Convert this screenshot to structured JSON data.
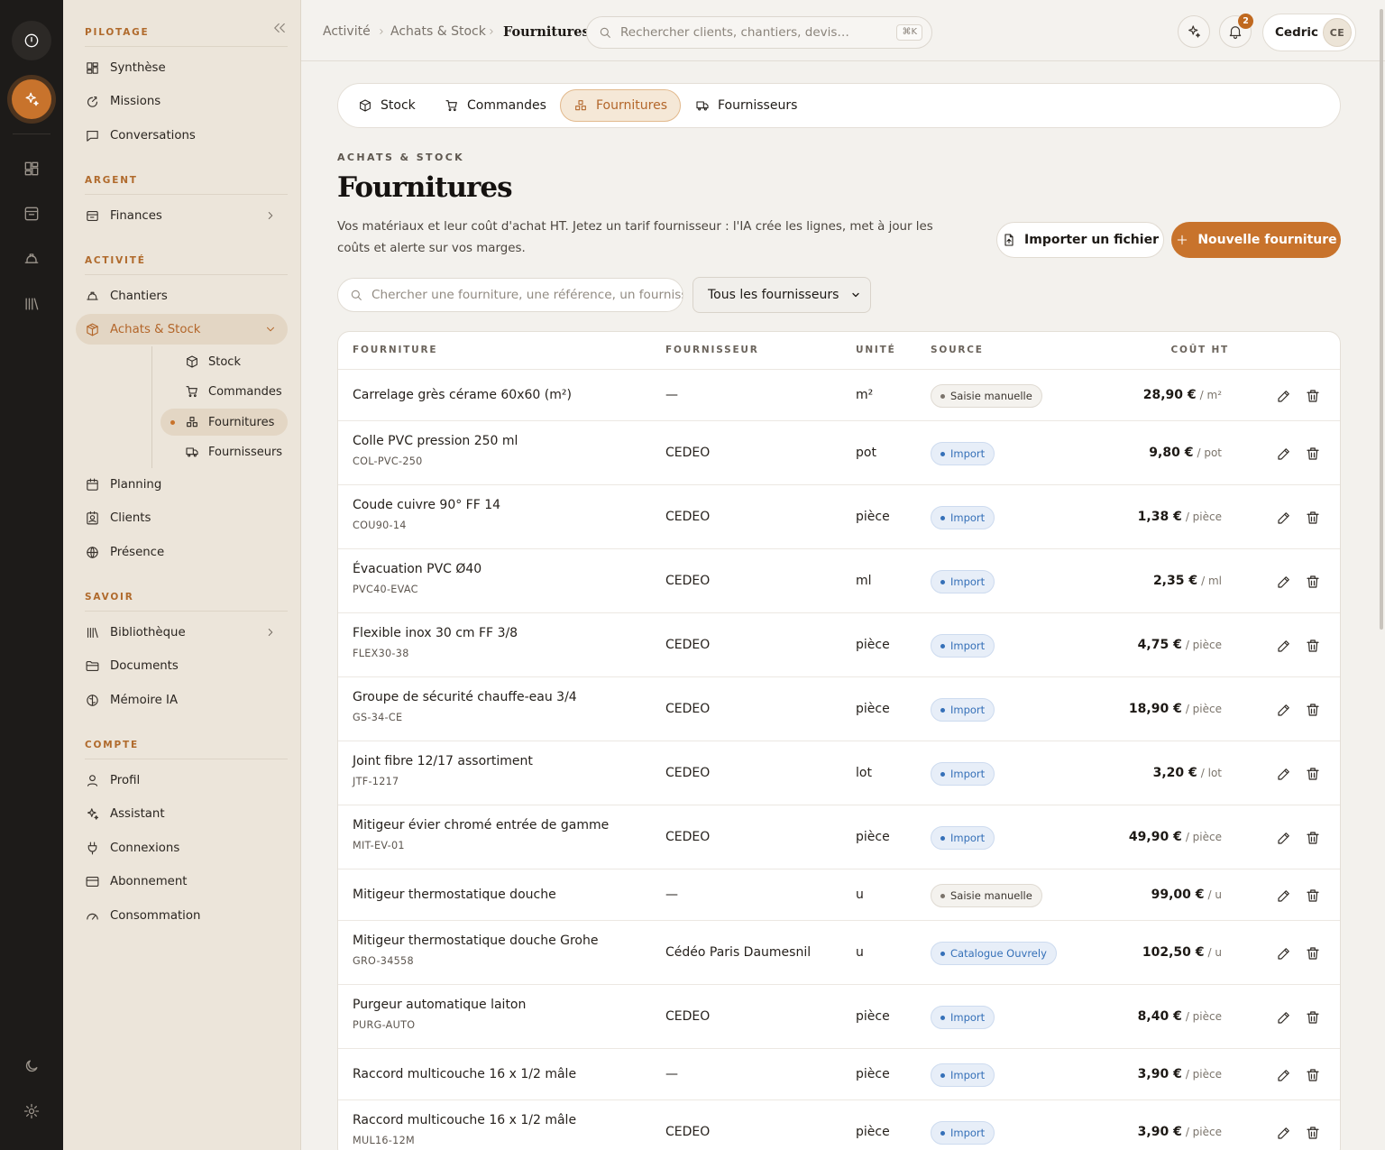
{
  "topbar": {
    "breadcrumb": [
      "Activité",
      "Achats & Stock",
      "Fournitures"
    ],
    "search_placeholder": "Rechercher clients, chantiers, devis…",
    "search_shortcut": "⌘K",
    "notifications_count": "2",
    "user_name": "Cedric",
    "user_initials": "CE"
  },
  "sidebar": {
    "sections": {
      "pilotage": "PILOTAGE",
      "argent": "ARGENT",
      "activite": "ACTIVITÉ",
      "savoir": "SAVOIR",
      "compte": "COMPTE"
    },
    "items": {
      "synthese": "Synthèse",
      "missions": "Missions",
      "conversations": "Conversations",
      "finances": "Finances",
      "chantiers": "Chantiers",
      "achats_stock": "Achats & Stock",
      "stock": "Stock",
      "commandes": "Commandes",
      "fournitures": "Fournitures",
      "fournisseurs": "Fournisseurs",
      "planning": "Planning",
      "clients": "Clients",
      "presence": "Présence",
      "bibliotheque": "Bibliothèque",
      "documents": "Documents",
      "memoire_ia": "Mémoire IA",
      "profil": "Profil",
      "assistant": "Assistant",
      "connexions": "Connexions",
      "abonnement": "Abonnement",
      "consommation": "Consommation"
    }
  },
  "tabs": [
    "Stock",
    "Commandes",
    "Fournitures",
    "Fournisseurs"
  ],
  "page": {
    "eyebrow": "ACHATS & STOCK",
    "title": "Fournitures",
    "description": "Vos matériaux et leur coût d'achat HT. Jetez un tarif fournisseur : l'IA crée les lignes, met à jour les coûts et alerte sur vos marges.",
    "import_button": "Importer un fichier",
    "new_button": "Nouvelle fourniture",
    "filter_placeholder": "Chercher une fourniture, une référence, un fournisseur",
    "supplier_filter": "Tous les fournisseurs"
  },
  "table": {
    "headers": {
      "fourniture": "FOURNITURE",
      "fournisseur": "FOURNISSEUR",
      "unite": "UNITÉ",
      "source": "SOURCE",
      "cout": "COÛT HT"
    },
    "rows": [
      {
        "name": "Carrelage grès cérame 60x60 (m²)",
        "ref": "",
        "supplier": "—",
        "unit": "m²",
        "source": "Saisie manuelle",
        "source_type": "manual",
        "price": "28,90 €",
        "price_unit": "/ m²"
      },
      {
        "name": "Colle PVC pression 250 ml",
        "ref": "COL-PVC-250",
        "supplier": "CEDEO",
        "unit": "pot",
        "source": "Import",
        "source_type": "import",
        "price": "9,80 €",
        "price_unit": "/ pot"
      },
      {
        "name": "Coude cuivre 90° FF 14",
        "ref": "COU90-14",
        "supplier": "CEDEO",
        "unit": "pièce",
        "source": "Import",
        "source_type": "import",
        "price": "1,38 €",
        "price_unit": "/ pièce"
      },
      {
        "name": "Évacuation PVC Ø40",
        "ref": "PVC40-EVAC",
        "supplier": "CEDEO",
        "unit": "ml",
        "source": "Import",
        "source_type": "import",
        "price": "2,35 €",
        "price_unit": "/ ml"
      },
      {
        "name": "Flexible inox 30 cm FF 3/8",
        "ref": "FLEX30-38",
        "supplier": "CEDEO",
        "unit": "pièce",
        "source": "Import",
        "source_type": "import",
        "price": "4,75 €",
        "price_unit": "/ pièce"
      },
      {
        "name": "Groupe de sécurité chauffe-eau 3/4",
        "ref": "GS-34-CE",
        "supplier": "CEDEO",
        "unit": "pièce",
        "source": "Import",
        "source_type": "import",
        "price": "18,90 €",
        "price_unit": "/ pièce"
      },
      {
        "name": "Joint fibre 12/17 assortiment",
        "ref": "JTF-1217",
        "supplier": "CEDEO",
        "unit": "lot",
        "source": "Import",
        "source_type": "import",
        "price": "3,20 €",
        "price_unit": "/ lot"
      },
      {
        "name": "Mitigeur évier chromé entrée de gamme",
        "ref": "MIT-EV-01",
        "supplier": "CEDEO",
        "unit": "pièce",
        "source": "Import",
        "source_type": "import",
        "price": "49,90 €",
        "price_unit": "/ pièce"
      },
      {
        "name": "Mitigeur thermostatique douche",
        "ref": "",
        "supplier": "—",
        "unit": "u",
        "source": "Saisie manuelle",
        "source_type": "manual",
        "price": "99,00 €",
        "price_unit": "/ u"
      },
      {
        "name": "Mitigeur thermostatique douche Grohe",
        "ref": "GRO-34558",
        "supplier": "Cédéo Paris Daumesnil",
        "unit": "u",
        "source": "Catalogue Ouvrely",
        "source_type": "import",
        "price": "102,50 €",
        "price_unit": "/ u"
      },
      {
        "name": "Purgeur automatique laiton",
        "ref": "PURG-AUTO",
        "supplier": "CEDEO",
        "unit": "pièce",
        "source": "Import",
        "source_type": "import",
        "price": "8,40 €",
        "price_unit": "/ pièce"
      },
      {
        "name": "Raccord multicouche 16 x 1/2 mâle",
        "ref": "",
        "supplier": "—",
        "unit": "pièce",
        "source": "Import",
        "source_type": "import",
        "price": "3,90 €",
        "price_unit": "/ pièce"
      },
      {
        "name": "Raccord multicouche 16 x 1/2 mâle",
        "ref": "MUL16-12M",
        "supplier": "CEDEO",
        "unit": "pièce",
        "source": "Import",
        "source_type": "import",
        "price": "3,90 €",
        "price_unit": "/ pièce"
      }
    ]
  },
  "colors": {
    "accent": "#c8732c",
    "rail_bg": "#1d1b19",
    "sidebar_bg": "#ece5da",
    "page_bg": "#f3f1ed",
    "import_blue": "#3570b8"
  }
}
